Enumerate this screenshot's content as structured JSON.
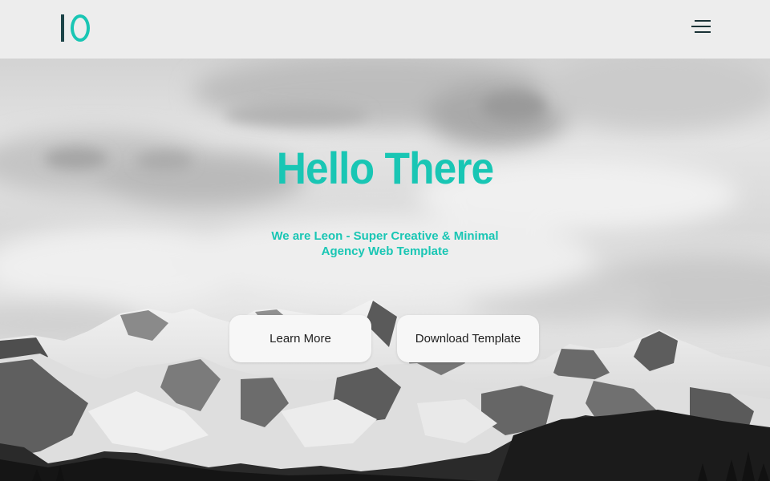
{
  "header": {
    "logo_icon": "io-logo-icon",
    "menu_icon": "hamburger-menu-icon"
  },
  "hero": {
    "title": "Hello There",
    "subtitle_line1": "We are Leon - Super Creative & Minimal",
    "subtitle_line2": "Agency Web Template",
    "learn_more_label": "Learn More",
    "download_label": "Download Template",
    "background_image": "snowy-mountains-grayscale"
  },
  "colors": {
    "accent": "#19c6b4",
    "logo_dark": "#1c4448",
    "header_bg": "#ededed",
    "button_bg": "#f7f7f7"
  }
}
